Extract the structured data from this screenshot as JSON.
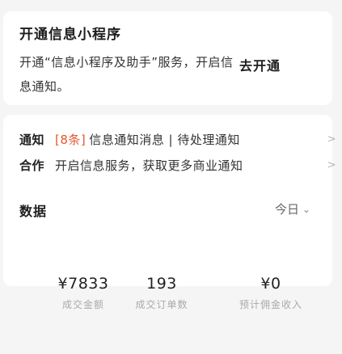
{
  "promo": {
    "title": "开通信息小程序",
    "text": "开通“信息小程序及助手”服务，开启信息通知。",
    "button_label": "去开通"
  },
  "rows": [
    {
      "label": "通知",
      "tag": "[8条]",
      "text": "信息通知消息 | 待处理通知",
      "chevron": ">"
    },
    {
      "label": "合作",
      "text": "开启信息服务，获取更多商业通知",
      "chevron": ">"
    }
  ],
  "data_section": {
    "title": "数据",
    "period": "今日",
    "period_dropdown": "⌄"
  },
  "stats": [
    {
      "value": "¥7833",
      "label": "成交金额"
    },
    {
      "value": "193",
      "label": "成交订单数"
    },
    {
      "value": "¥0",
      "label": "预计佣金收入"
    }
  ]
}
